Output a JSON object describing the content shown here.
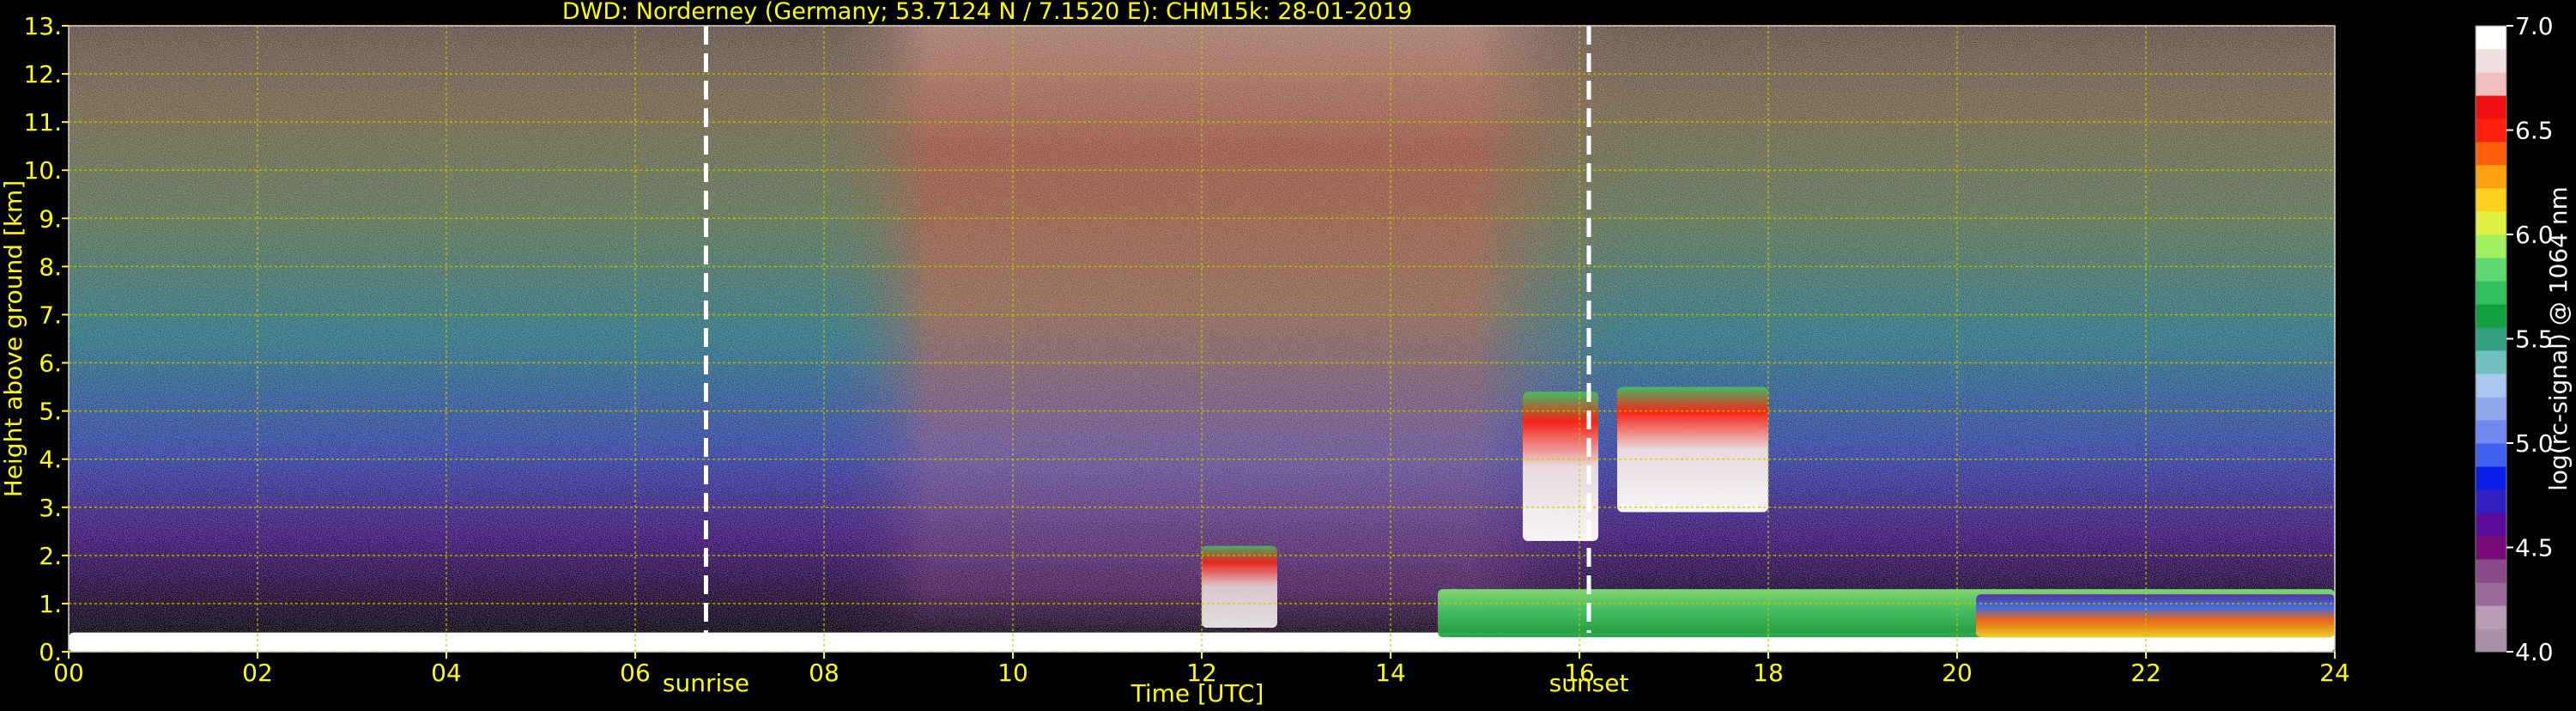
{
  "chart_data": {
    "type": "heatmap",
    "title": "DWD: Norderney (Germany; 53.7124 N / 7.1520 E):    CHM15k: 28-01-2019",
    "xlabel": "Time [UTC]",
    "ylabel": "Height above ground [km]",
    "xlim": [
      0,
      24
    ],
    "ylim": [
      0,
      13
    ],
    "x_ticks": [
      "00",
      "02",
      "04",
      "06",
      "08",
      "10",
      "12",
      "14",
      "16",
      "18",
      "20",
      "22",
      "24"
    ],
    "y_ticks": [
      "0.",
      "1.",
      "2.",
      "3.",
      "4.",
      "5.",
      "6.",
      "7.",
      "8.",
      "9.",
      "10.",
      "11.",
      "12.",
      "13."
    ],
    "grid": true,
    "colorbar": {
      "label": "log(rc-signal) @ 1064 nm",
      "range": [
        4.0,
        7.0
      ],
      "ticks": [
        "4.0",
        "4.5",
        "5.0",
        "5.5",
        "6.0",
        "6.5",
        "7.0"
      ],
      "colors": [
        "#a890a8",
        "#b89cb8",
        "#9a6a9a",
        "#8a4a8a",
        "#780a78",
        "#5a0a9a",
        "#3020c0",
        "#0a1ee8",
        "#4060f0",
        "#7088f0",
        "#90a8f0",
        "#a8c8f0",
        "#70c0c0",
        "#30a080",
        "#10a040",
        "#30c060",
        "#60d870",
        "#a0f060",
        "#e0f040",
        "#ffd020",
        "#ffa010",
        "#ff6010",
        "#ff2010",
        "#f01010",
        "#f0c0c0",
        "#f0e0e0",
        "#ffffff"
      ]
    },
    "annotations": [
      {
        "label": "sunrise",
        "x": 6.75
      },
      {
        "label": "sunset",
        "x": 16.1
      }
    ],
    "features": [
      {
        "kind": "surface-layer",
        "x": [
          0,
          24
        ],
        "height_km": [
          0,
          0.4
        ]
      },
      {
        "kind": "aerosol-boundary-layer",
        "x": [
          14.5,
          24
        ],
        "height_km": [
          0.3,
          1.3
        ]
      },
      {
        "kind": "elevated-cloud",
        "x": [
          15.4,
          16.2
        ],
        "height_km": [
          2.3,
          5.4
        ]
      },
      {
        "kind": "elevated-cloud",
        "x": [
          16.4,
          18.0
        ],
        "height_km": [
          2.9,
          5.5
        ]
      },
      {
        "kind": "low-cloud",
        "x": [
          12.0,
          12.8
        ],
        "height_km": [
          0.5,
          2.2
        ]
      }
    ],
    "colors": {
      "axis_text": "#ffff00",
      "grid": "#c8c800",
      "annotation_line": "#ffffff",
      "annotation_text": "#ffff00",
      "colorbar_text": "#ffffff"
    }
  }
}
